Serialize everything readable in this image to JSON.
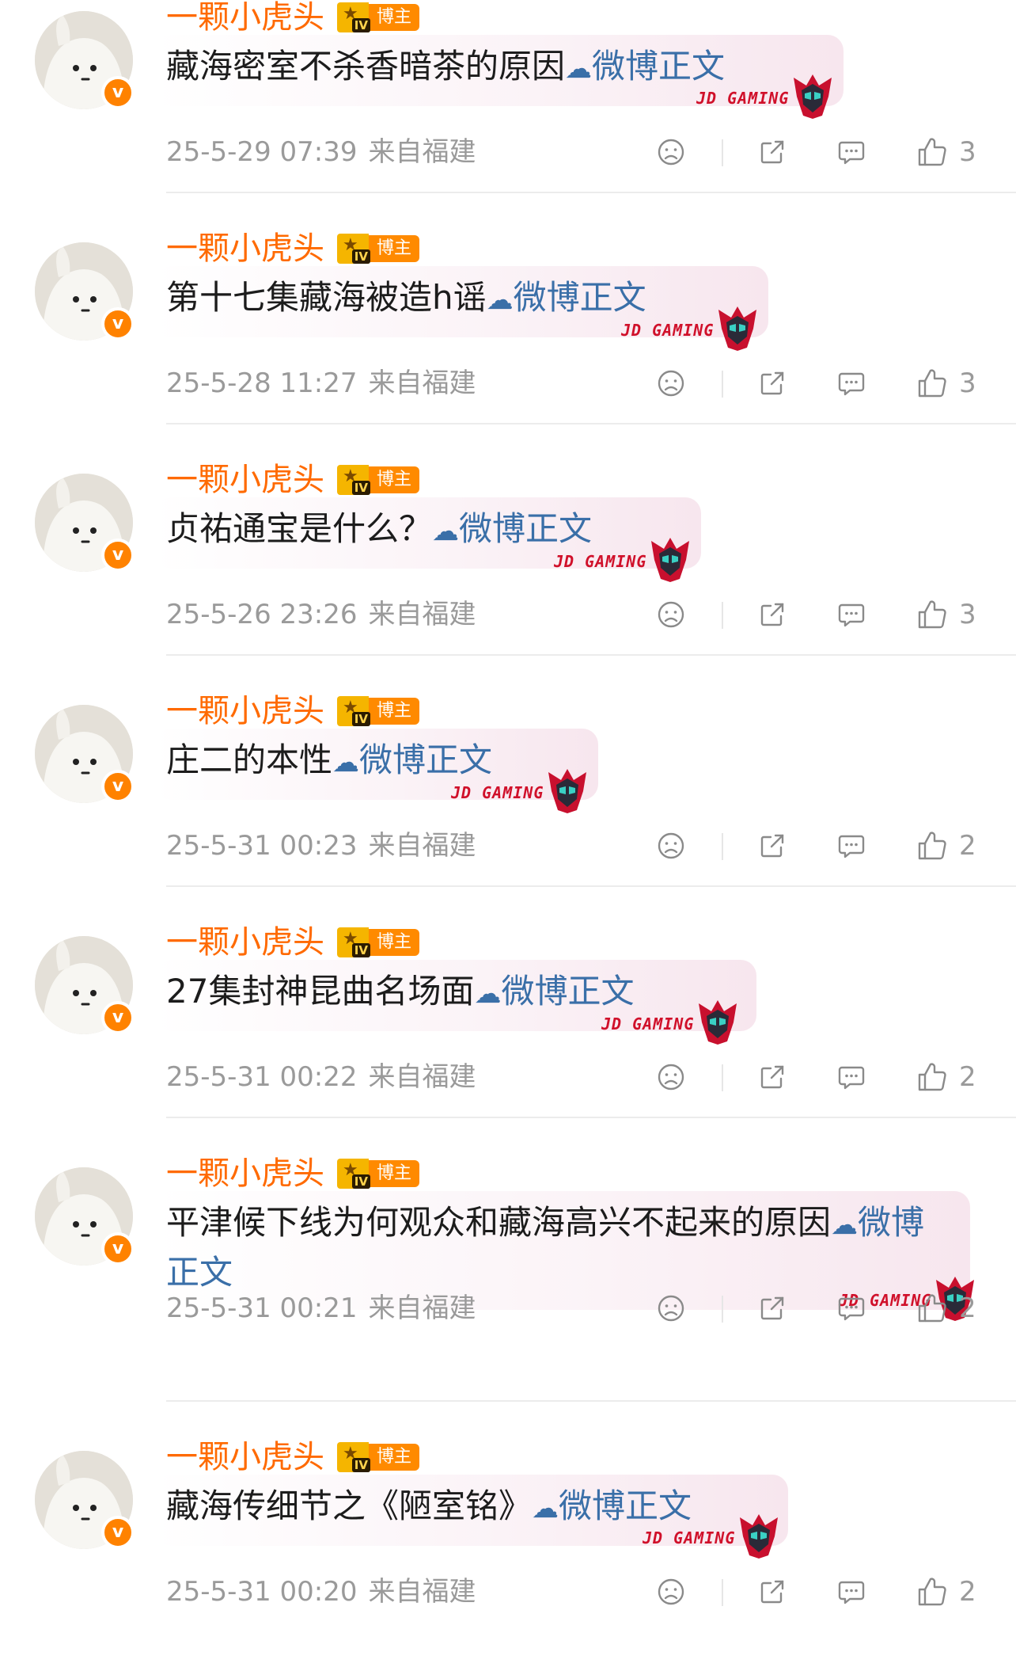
{
  "colors": {
    "username": "#ff6a00",
    "link": "#3a6fa8",
    "meta": "#9a9a9a",
    "verified_badge": "#ff8200",
    "jdg_red": "#d0102a"
  },
  "icons": {
    "dislike": "sad-face-icon",
    "share": "share-icon",
    "comment": "comment-bubble-icon",
    "like": "thumbs-up-icon",
    "link_prefix": "cloud-link-icon"
  },
  "comments": [
    {
      "username": "一颗小虎头",
      "rank_badge": "博主",
      "level": "IV",
      "text": "藏海密室不杀香暗茶的原因",
      "link_text": "微博正文",
      "decoration": "JD GAMING",
      "time": "25-5-29 07:39",
      "source": "来自福建",
      "likes": "3"
    },
    {
      "username": "一颗小虎头",
      "rank_badge": "博主",
      "level": "IV",
      "text": "第十七集藏海被造h谣",
      "link_text": "微博正文",
      "decoration": "JD GAMING",
      "time": "25-5-28 11:27",
      "source": "来自福建",
      "likes": "3"
    },
    {
      "username": "一颗小虎头",
      "rank_badge": "博主",
      "level": "IV",
      "text": "贞祐通宝是什么？",
      "link_text": "微博正文",
      "decoration": "JD GAMING",
      "time": "25-5-26 23:26",
      "source": "来自福建",
      "likes": "3"
    },
    {
      "username": "一颗小虎头",
      "rank_badge": "博主",
      "level": "IV",
      "text": "庄二的本性",
      "link_text": "微博正文",
      "decoration": "JD GAMING",
      "time": "25-5-31 00:23",
      "source": "来自福建",
      "likes": "2"
    },
    {
      "username": "一颗小虎头",
      "rank_badge": "博主",
      "level": "IV",
      "text": "27集封神昆曲名场面",
      "link_text": "微博正文",
      "decoration": "JD GAMING",
      "time": "25-5-31 00:22",
      "source": "来自福建",
      "likes": "2"
    },
    {
      "username": "一颗小虎头",
      "rank_badge": "博主",
      "level": "IV",
      "text": "平津候下线为何观众和藏海高兴不起来的原因",
      "link_text": "微博正文",
      "decoration": "JD GAMING",
      "time": "25-5-31 00:21",
      "source": "来自福建",
      "likes": "2"
    },
    {
      "username": "一颗小虎头",
      "rank_badge": "博主",
      "level": "IV",
      "text": "藏海传细节之《陋室铭》",
      "link_text": "微博正文",
      "decoration": "JD GAMING",
      "time": "25-5-31 00:20",
      "source": "来自福建",
      "likes": "2"
    }
  ]
}
